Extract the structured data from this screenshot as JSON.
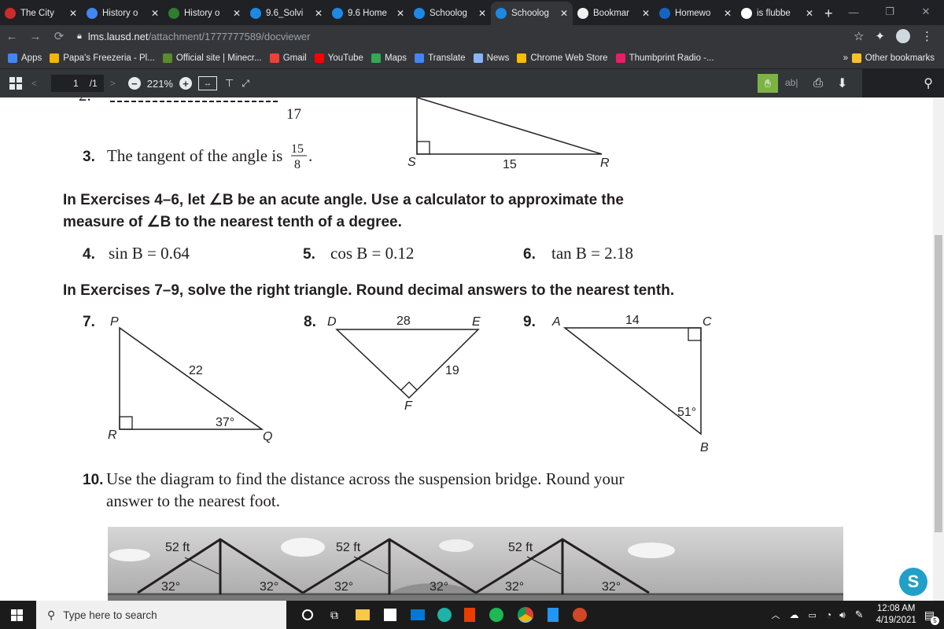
{
  "tabs": [
    {
      "title": "The City",
      "icon": "city-favicon",
      "color": "#cc2b2b",
      "active": false
    },
    {
      "title": "History o",
      "icon": "history-favicon",
      "color": "#4285f4",
      "active": false
    },
    {
      "title": "History o",
      "icon": "history-favicon",
      "color": "#2e7d32",
      "active": false
    },
    {
      "title": "9.6_Solvi",
      "icon": "schoology-favicon",
      "color": "#1e88e5",
      "active": false
    },
    {
      "title": "9.6 Home",
      "icon": "schoology-favicon",
      "color": "#1e88e5",
      "active": false
    },
    {
      "title": "Schoolog",
      "icon": "schoology-favicon",
      "color": "#1e88e5",
      "active": false
    },
    {
      "title": "Schoolog",
      "icon": "schoology-favicon",
      "color": "#1e88e5",
      "active": true
    },
    {
      "title": "Bookmar",
      "icon": "star-favicon",
      "color": "#f1f1f1",
      "active": false
    },
    {
      "title": "Homewo",
      "icon": "homework-favicon",
      "color": "#1565c0",
      "active": false
    },
    {
      "title": "is flubbe",
      "icon": "google-favicon",
      "color": "#ffffff",
      "active": false
    }
  ],
  "window_controls": {
    "minimize": "—",
    "restore": "❐",
    "close": "✕"
  },
  "address": {
    "host": "lms.lausd.net",
    "path": "/attachment/1777777589/docviewer"
  },
  "bookmarks": [
    {
      "label": "Apps",
      "color": "#4285f4"
    },
    {
      "label": "Papa's Freezeria - Pl...",
      "color": "#f4b400"
    },
    {
      "label": "Official site | Minecr...",
      "color": "#5b8c2a"
    },
    {
      "label": "Gmail",
      "color": "#ea4335"
    },
    {
      "label": "YouTube",
      "color": "#ff0000"
    },
    {
      "label": "Maps",
      "color": "#34a853"
    },
    {
      "label": "Translate",
      "color": "#4285f4"
    },
    {
      "label": "News",
      "color": "#8ab4f8"
    },
    {
      "label": "Chrome Web Store",
      "color": "#fbbc04"
    },
    {
      "label": "Thumbprint Radio -...",
      "color": "#e91e63"
    }
  ],
  "bookmarks_more": "»",
  "other_bookmarks": "Other bookmarks",
  "pdf": {
    "page_current": "1",
    "page_total": "/1",
    "zoom": "221%"
  },
  "doc": {
    "q2_tail_num": "17",
    "q3_num": "3.",
    "q3_text": "The tangent of the angle is",
    "q3_frac_num": "15",
    "q3_frac_den": "8",
    "tri_top": {
      "s": "S",
      "r": "R",
      "side": "15"
    },
    "heading1a": "In Exercises 4–6, let ∠B be an acute angle. Use a calculator to approximate the",
    "heading1b": "measure of ∠B to the nearest tenth of a degree.",
    "q4_num": "4.",
    "q4_text": "sin B = 0.64",
    "q5_num": "5.",
    "q5_text": "cos B = 0.12",
    "q6_num": "6.",
    "q6_text": "tan B = 2.18",
    "heading2": "In Exercises 7–9, solve the right triangle. Round decimal answers to the nearest tenth.",
    "q7": {
      "num": "7.",
      "p": "P",
      "r": "R",
      "q": "Q",
      "hyp": "22",
      "angle": "37°"
    },
    "q8": {
      "num": "8.",
      "d": "D",
      "e": "E",
      "f": "F",
      "top": "28",
      "side": "19"
    },
    "q9": {
      "num": "9.",
      "a": "A",
      "c": "C",
      "b": "B",
      "top": "14",
      "angle": "51°"
    },
    "q10_num": "10.",
    "q10_line1": "Use the diagram to find the distance across the suspension bridge. Round your",
    "q10_line2": "answer to the nearest foot.",
    "bridge": {
      "tower1": "52 ft",
      "tower2": "52 ft",
      "tower3": "52 ft",
      "angle": "32°"
    }
  },
  "taskbar": {
    "search_placeholder": "Type here to search",
    "time": "12:08 AM",
    "date": "4/19/2021",
    "notif_count": "5"
  }
}
